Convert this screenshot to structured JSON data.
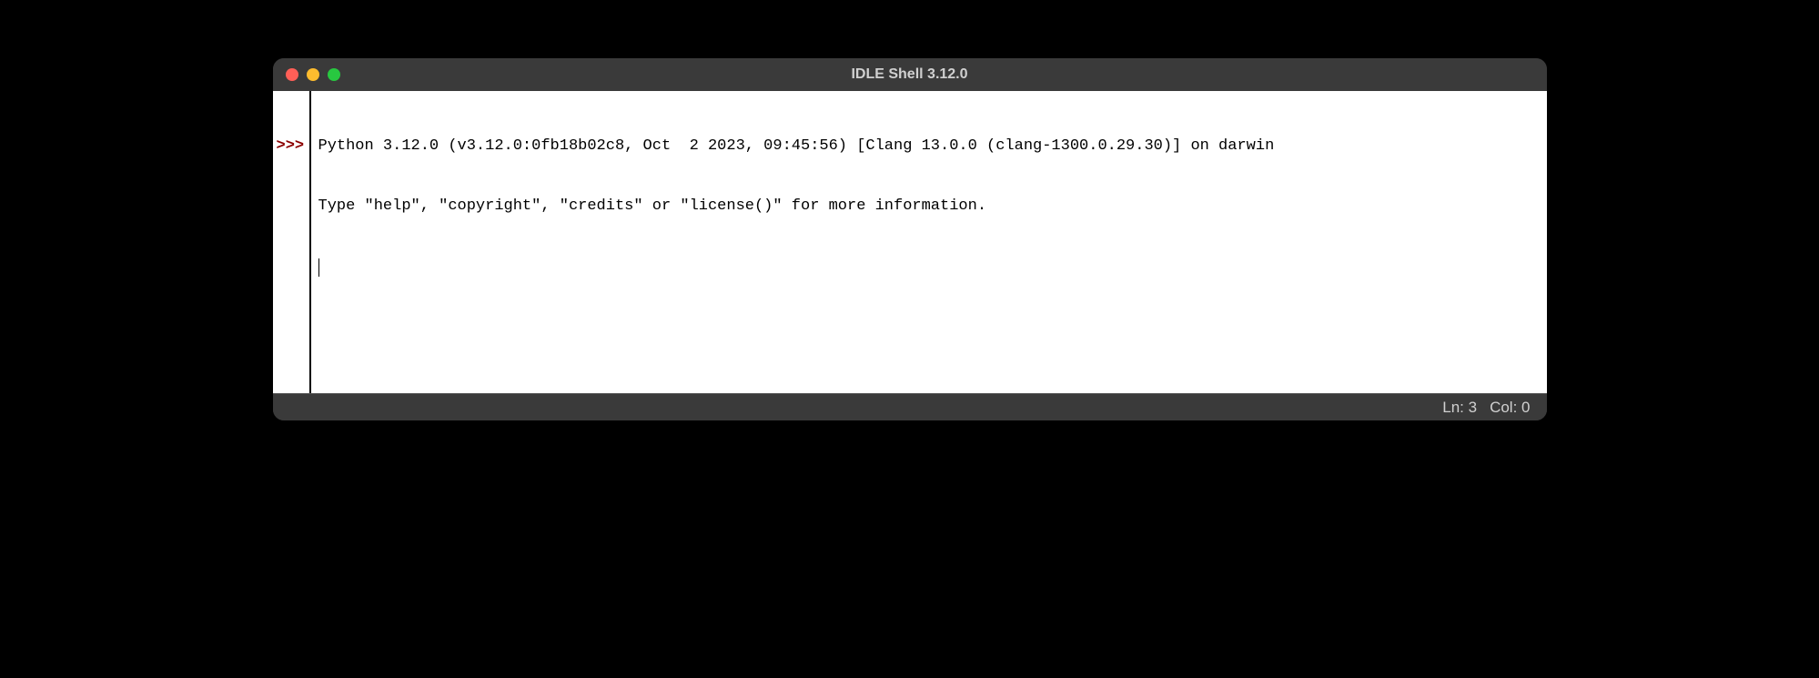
{
  "window": {
    "title": "IDLE Shell 3.12.0"
  },
  "shell": {
    "banner_line1": "Python 3.12.0 (v3.12.0:0fb18b02c8, Oct  2 2023, 09:45:56) [Clang 13.0.0 (clang-1300.0.29.30)] on darwin",
    "banner_line2": "Type \"help\", \"copyright\", \"credits\" or \"license()\" for more information.",
    "prompt": ">>>"
  },
  "status": {
    "line_label": "Ln: 3",
    "col_label": "Col: 0"
  }
}
